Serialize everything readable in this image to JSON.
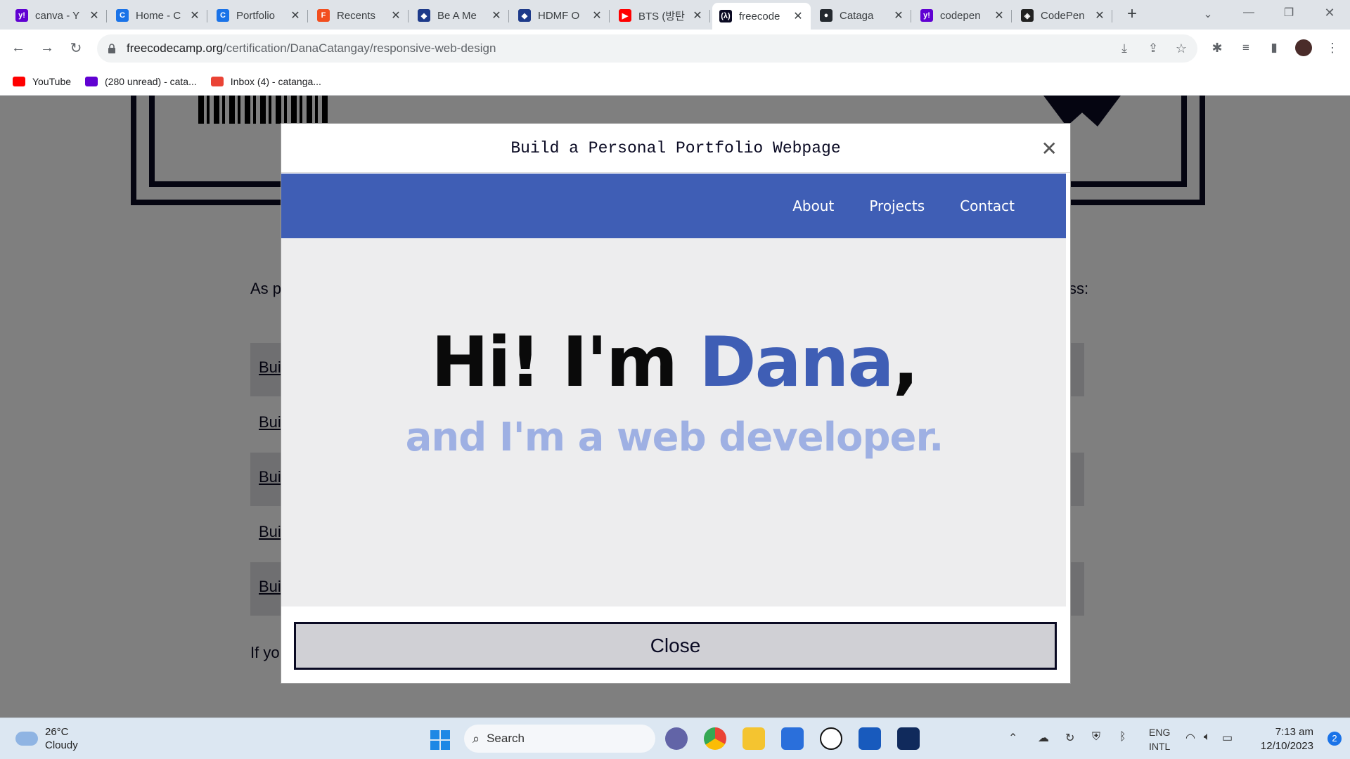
{
  "browser": {
    "tabs": [
      {
        "title": "canva - Y",
        "icon": "yahoo-icon",
        "color": "#6001d2",
        "glyph": "y!"
      },
      {
        "title": "Home - C",
        "icon": "canva-icon",
        "color": "#1a73e8",
        "glyph": "C"
      },
      {
        "title": "Portfolio",
        "icon": "canva-icon",
        "color": "#1a73e8",
        "glyph": "C"
      },
      {
        "title": "Recents",
        "icon": "figma-icon",
        "color": "#f24e1e",
        "glyph": "F"
      },
      {
        "title": "Be A Me",
        "icon": "shield-icon",
        "color": "#1d3a8a",
        "glyph": "◆"
      },
      {
        "title": "HDMF O",
        "icon": "shield-icon",
        "color": "#1d3a8a",
        "glyph": "◆"
      },
      {
        "title": "BTS (방탄",
        "icon": "youtube-icon",
        "color": "#ff0000",
        "glyph": "▶"
      },
      {
        "title": "freecode",
        "icon": "freecodecamp-icon",
        "color": "#0a0a23",
        "glyph": "(λ)",
        "active": true
      },
      {
        "title": "Cataga",
        "icon": "github-icon",
        "color": "#24292f",
        "glyph": "●"
      },
      {
        "title": "codepen",
        "icon": "yahoo-icon",
        "color": "#6001d2",
        "glyph": "y!"
      },
      {
        "title": "CodePen",
        "icon": "codepen-icon",
        "color": "#222222",
        "glyph": "◈"
      }
    ],
    "url_host": "freecodecamp.org",
    "url_path": "/certification/DanaCatangay/responsive-web-design",
    "bookmarks": [
      {
        "label": "YouTube",
        "color": "#ff0000"
      },
      {
        "label": "(280 unread) - cata...",
        "color": "#6001d2"
      },
      {
        "label": "Inbox (4) - catanga...",
        "color": "#ea4335"
      }
    ]
  },
  "background_page": {
    "intro_fragment_left": "As p",
    "intro_fragment_right": "ss:",
    "row_fragments": [
      "Bui",
      "Bui",
      "Bui",
      "Bui",
      "Bui"
    ],
    "footer_fragment": "If yo"
  },
  "modal": {
    "title": "Build a Personal Portfolio Webpage",
    "close_label": "Close",
    "preview": {
      "nav": [
        "About",
        "Projects",
        "Contact"
      ],
      "hero_prefix": "Hi! I'm ",
      "hero_name": "Dana",
      "hero_suffix": ",",
      "subtitle": "and I'm a web developer.",
      "accent_color": "#3f5eb5",
      "subtitle_color": "#9eb0e3"
    }
  },
  "taskbar": {
    "temperature": "26°C",
    "weather": "Cloudy",
    "search_placeholder": "Search",
    "language": "ENG",
    "layout": "INTL",
    "time": "7:13 am",
    "date": "12/10/2023",
    "notification_count": "2"
  }
}
